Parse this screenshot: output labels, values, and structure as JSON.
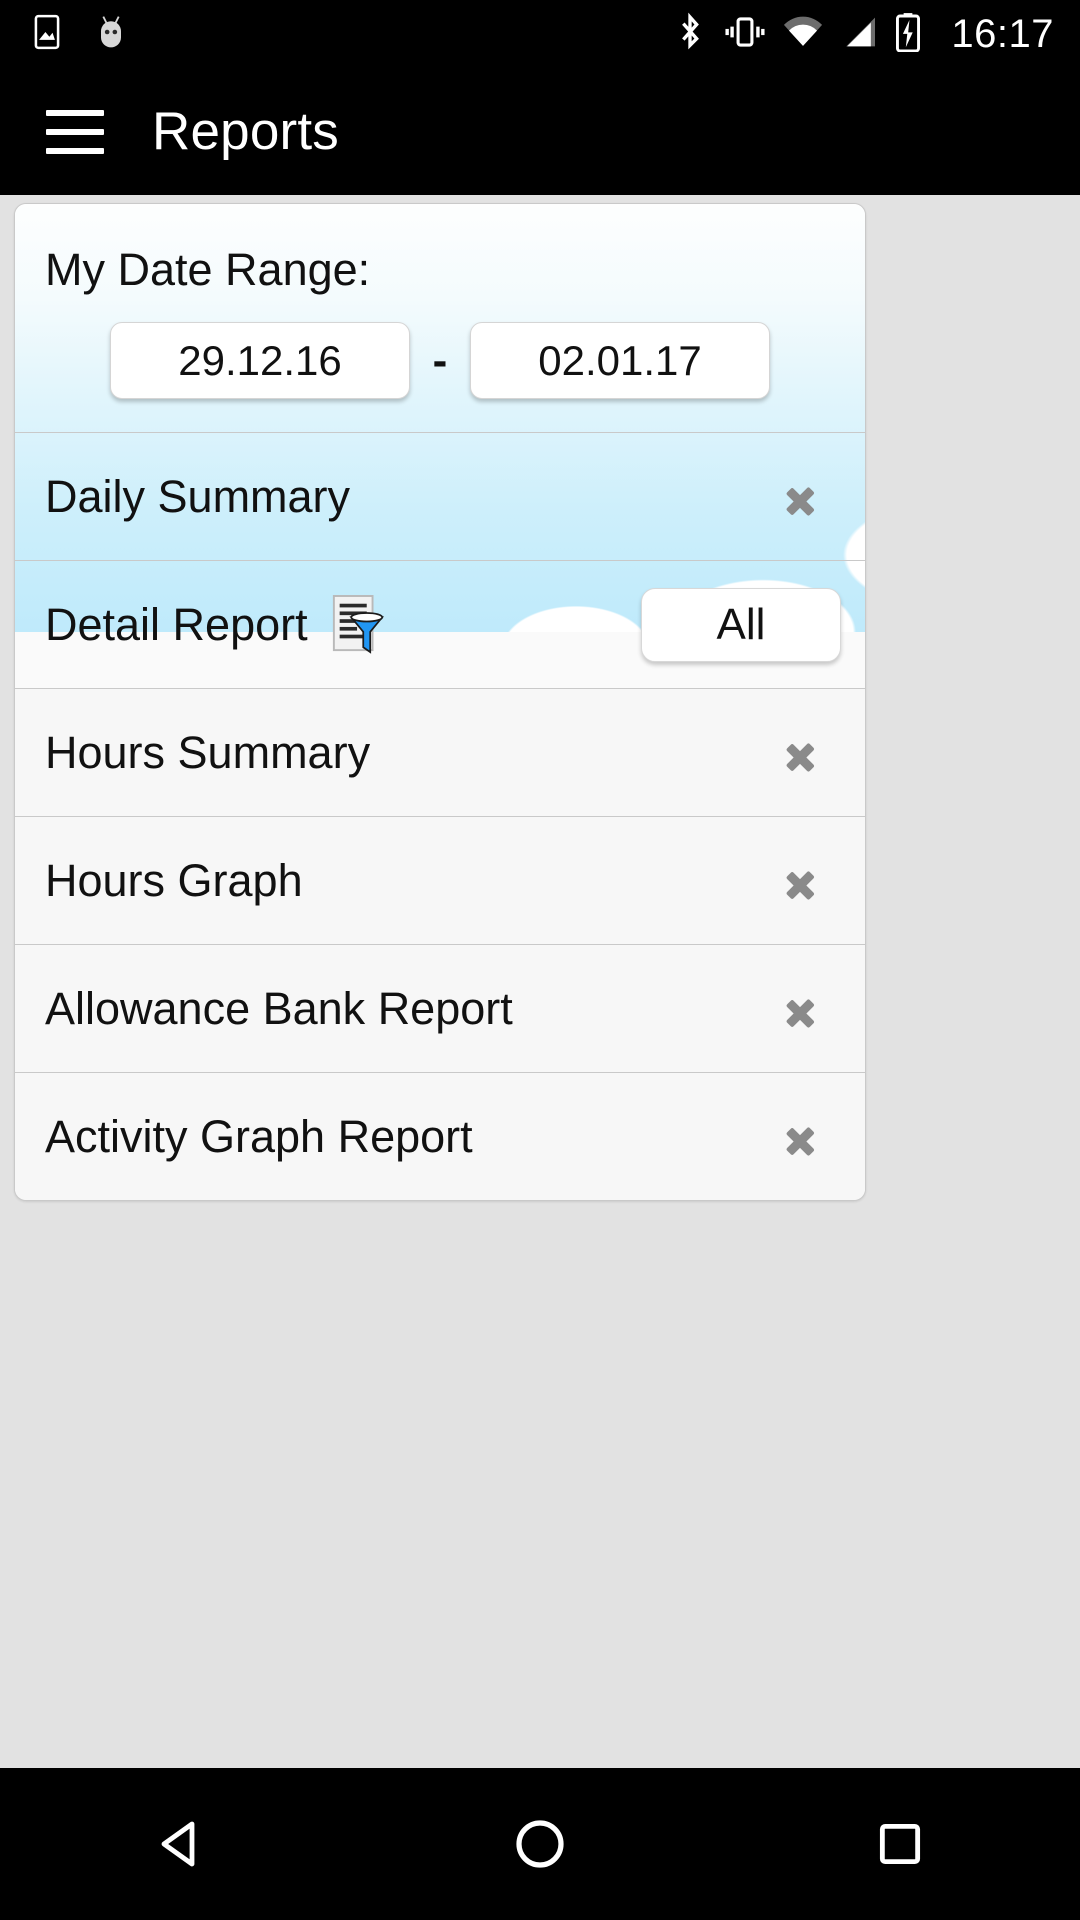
{
  "statusbar": {
    "icons": [
      "image-icon",
      "android-head-icon",
      "bluetooth-icon",
      "vibrate-icon",
      "wifi-icon",
      "signal-icon",
      "battery-charging-icon"
    ],
    "clock": "16:17"
  },
  "appbar": {
    "menu_icon": "hamburger-menu-icon",
    "title": "Reports"
  },
  "date_range": {
    "label": "My Date Range:",
    "start_date": "29.12.16",
    "separator": "-",
    "end_date": "02.01.17"
  },
  "reports": [
    {
      "label": "Daily Summary",
      "accessory": "chevron"
    },
    {
      "label": "Detail Report",
      "accessory": "all-button",
      "icon": "filter-report-icon",
      "button_label": "All"
    },
    {
      "label": "Hours Summary",
      "accessory": "chevron"
    },
    {
      "label": "Hours Graph",
      "accessory": "chevron"
    },
    {
      "label": "Allowance Bank Report",
      "accessory": "chevron"
    },
    {
      "label": "Activity Graph Report",
      "accessory": "chevron"
    }
  ],
  "navbar": {
    "back": "back-triangle-icon",
    "home": "home-circle-icon",
    "recents": "recents-square-icon"
  },
  "colors": {
    "appbar_bg": "#000000",
    "page_bg": "#e2e2e2",
    "sky_blue": "#bfeafb",
    "accent_blue": "#2196f3",
    "divider": "#c9c9c9",
    "text": "#111111",
    "chevron_gray": "#8a8a8a"
  }
}
